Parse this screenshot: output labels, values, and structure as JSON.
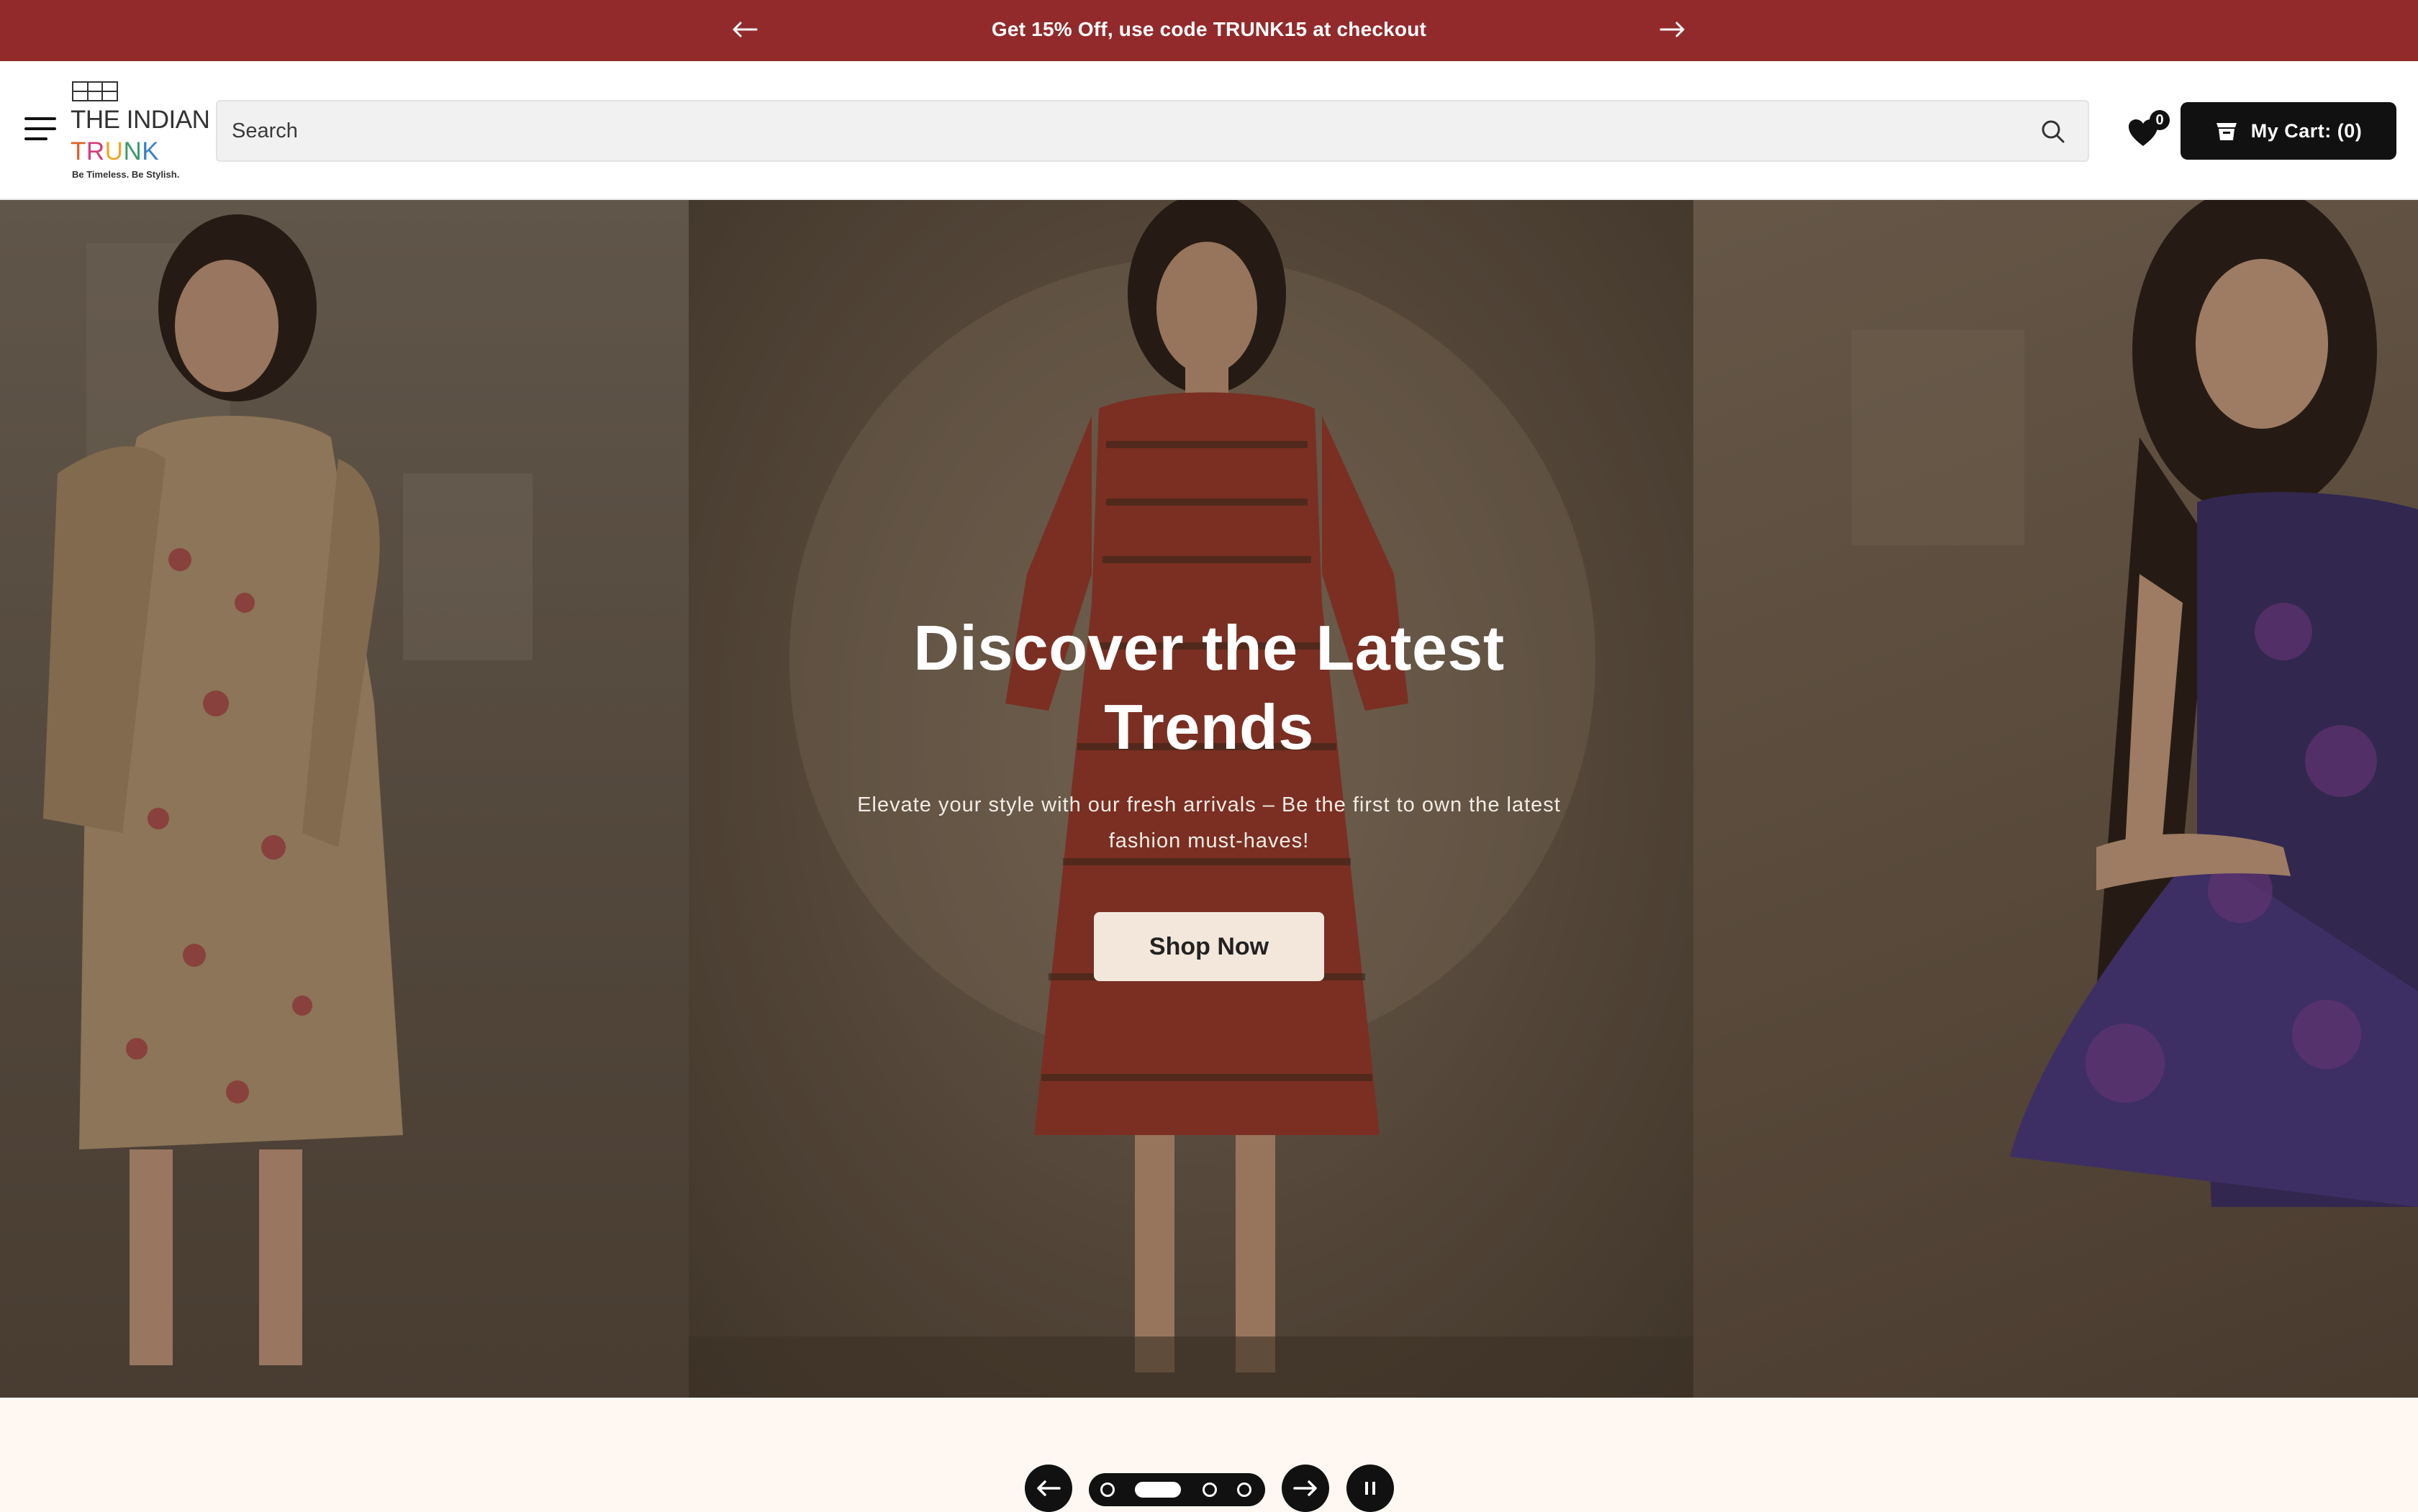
{
  "announcement": {
    "message": "Get 15% Off, use code TRUNK15 at checkout",
    "prev_icon": "arrow-left-icon",
    "next_icon": "arrow-right-icon"
  },
  "header": {
    "menu_icon": "hamburger-menu-icon",
    "logo": {
      "line1": "THE INDIAN",
      "line2_letters": [
        "T",
        "R",
        "U",
        "N",
        "K"
      ],
      "tagline": "Be Timeless. Be Stylish."
    },
    "search": {
      "placeholder": "Search",
      "icon": "search-icon"
    },
    "wishlist": {
      "icon": "heart-icon",
      "count": "0"
    },
    "cart": {
      "icon": "cart-icon",
      "label": "My Cart: (0)"
    }
  },
  "hero": {
    "title": "Discover the Latest Trends",
    "subtitle": "Elevate your style with our fresh arrivals – Be the first to own the latest fashion must-haves!",
    "cta_label": "Shop Now"
  },
  "slider": {
    "prev_icon": "arrow-left-icon",
    "next_icon": "arrow-right-icon",
    "pause_icon": "pause-icon",
    "slide_count": 4,
    "active_slide": 2
  },
  "colors": {
    "announcement_bg": "#922a2c",
    "logo_letters": [
      "#e0612a",
      "#d63a7a",
      "#f2a623",
      "#3a9a6a",
      "#3b7fc4"
    ],
    "cta_bg": "#f3e7dc",
    "page_bg": "#fff7f2"
  }
}
